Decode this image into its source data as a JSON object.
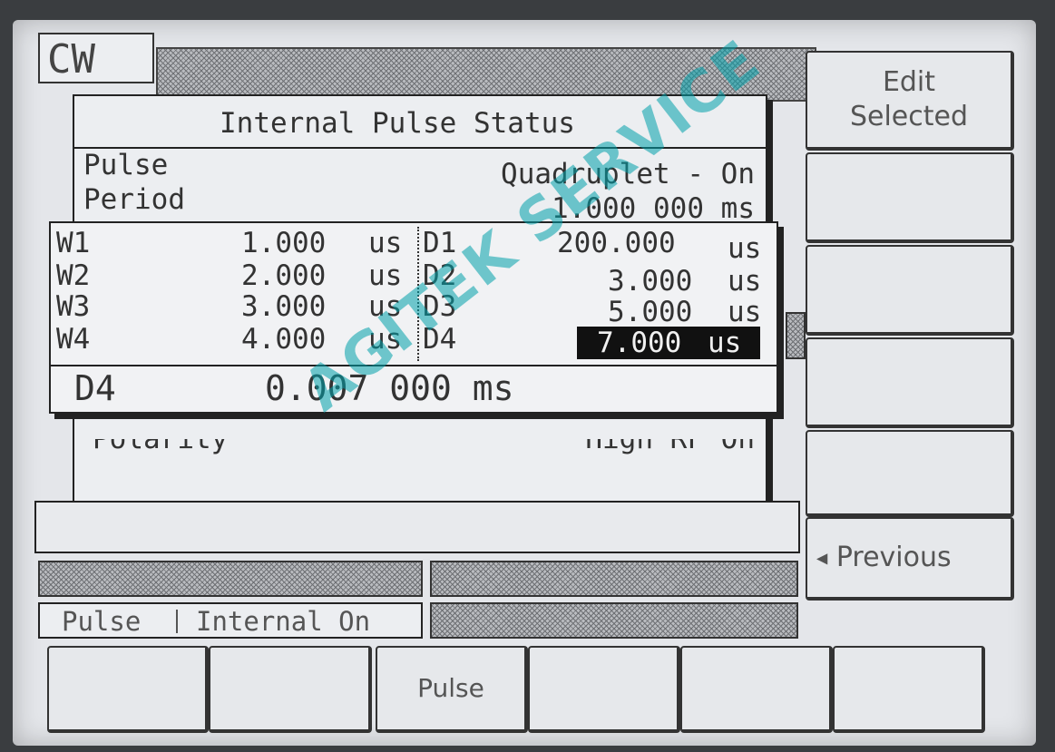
{
  "header": {
    "mode": "CW"
  },
  "status_panel": {
    "title": "Internal Pulse Status",
    "rows": [
      {
        "label": "Pulse",
        "value": "Quadruplet -  On"
      },
      {
        "label": "Period",
        "value": "1.000 000 ms"
      }
    ],
    "hidden_row": {
      "label": "Polarity",
      "value": "High RF On"
    }
  },
  "pulse_table": {
    "widths": [
      {
        "label": "W1",
        "value": "1.000",
        "unit": "us"
      },
      {
        "label": "W2",
        "value": "2.000",
        "unit": "us"
      },
      {
        "label": "W3",
        "value": "3.000",
        "unit": "us"
      },
      {
        "label": "W4",
        "value": "4.000",
        "unit": "us"
      }
    ],
    "delays": [
      {
        "label": "D1",
        "value": "200.000",
        "unit": "us"
      },
      {
        "label": "D2",
        "value": "3.000",
        "unit": "us"
      },
      {
        "label": "D3",
        "value": "5.000",
        "unit": "us"
      },
      {
        "label": "D4",
        "value": "7.000",
        "unit": "us"
      }
    ],
    "selected": "D4"
  },
  "entry": {
    "param": "D4",
    "value": "0.007 000 ms"
  },
  "status_bar": {
    "pulse_label": "Pulse",
    "pulse_state": "Internal On"
  },
  "right_softkeys": {
    "edit_selected": "Edit Selected",
    "previous": "Previous"
  },
  "bottom_softkeys": {
    "pulse": "Pulse"
  },
  "watermark": "AGITEK SERVICE"
}
